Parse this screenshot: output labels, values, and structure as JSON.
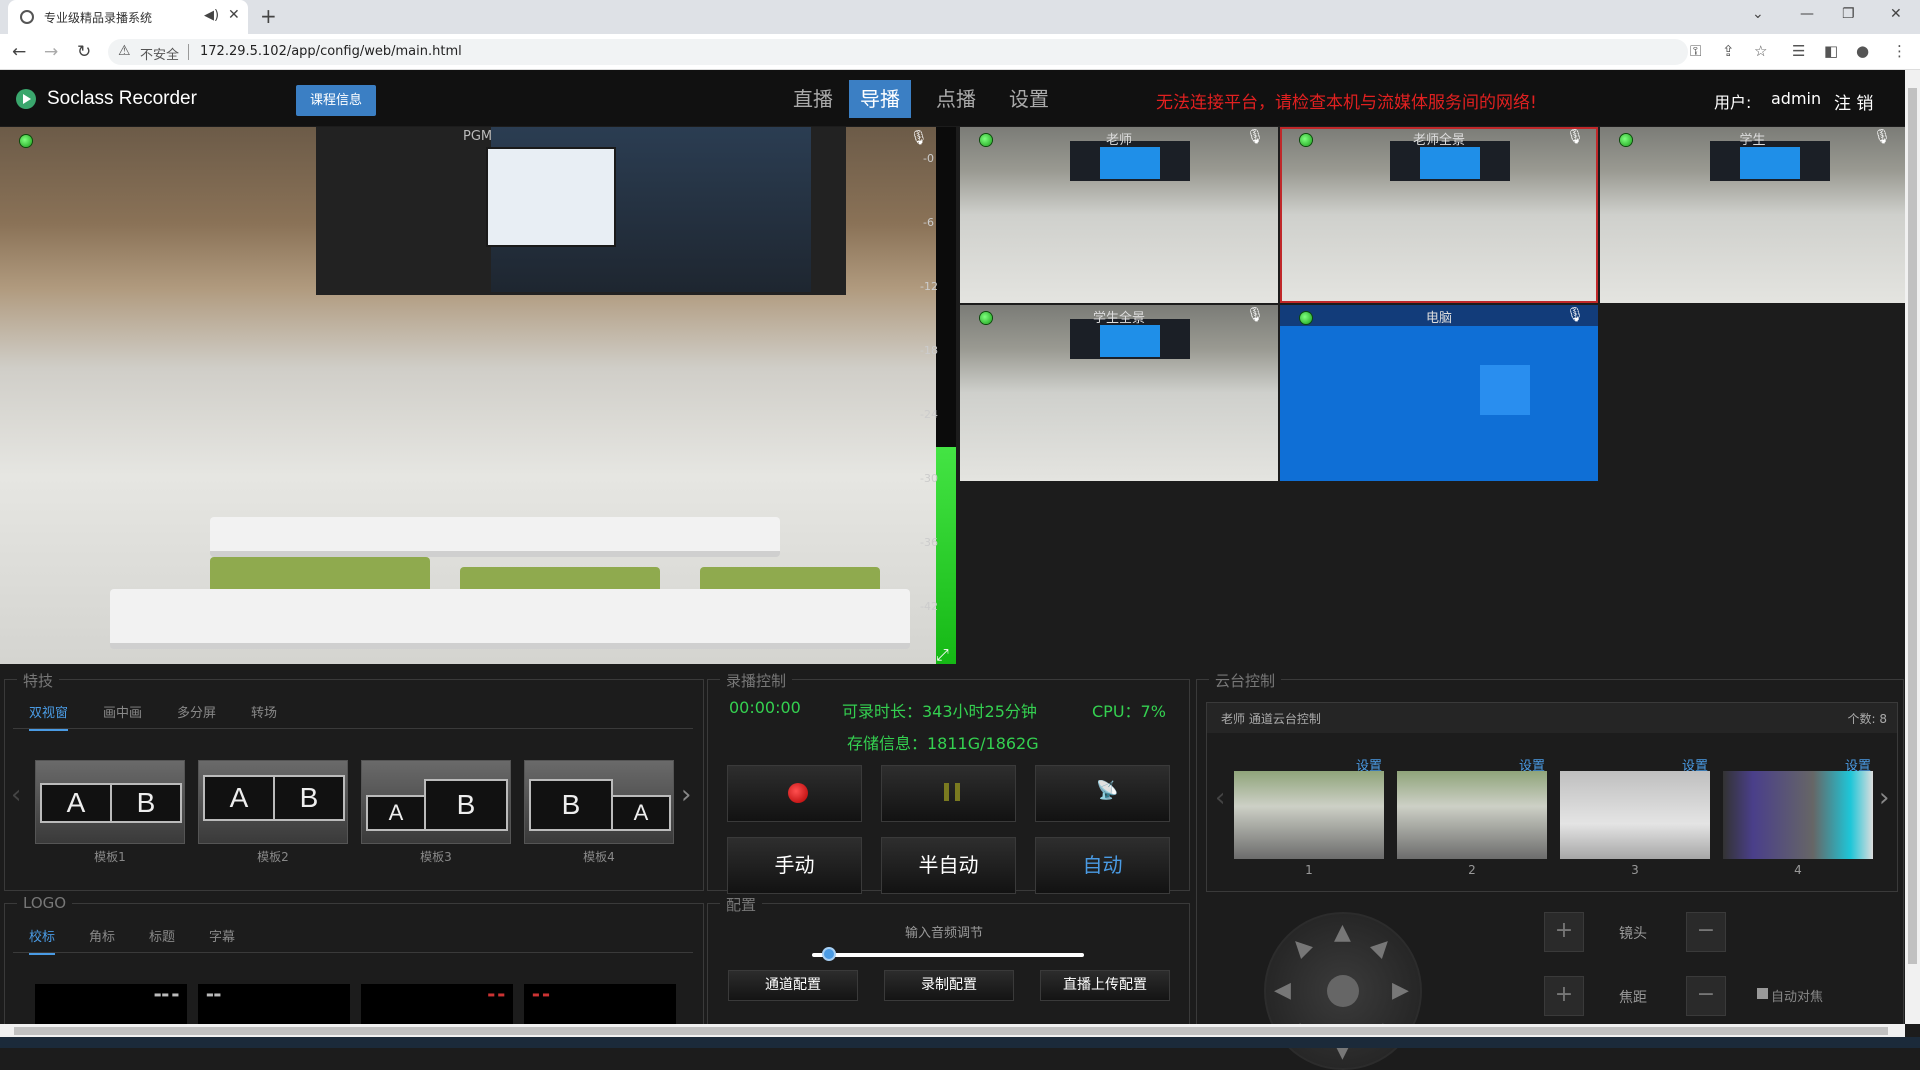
{
  "browser": {
    "tab_title": "专业级精品录播系统",
    "url": "172.29.5.102/app/config/web/main.html",
    "security_label": "不安全"
  },
  "header": {
    "app_name": "Soclass Recorder",
    "course_button": "课程信息",
    "nav": [
      "直播",
      "导播",
      "点播",
      "设置"
    ],
    "active_nav": "导播",
    "warning": "无法连接平台，请检查本机与流媒体服务间的网络!",
    "user_label": "用户:",
    "user_name": "admin",
    "logout": "注 销"
  },
  "pgm": {
    "label": "PGM",
    "meter_ticks": [
      "-0",
      "-6",
      "-12",
      "-18",
      "-24",
      "-30",
      "-36",
      "-42"
    ],
    "audio_level_db": -30
  },
  "cameras": [
    {
      "label": "老师",
      "selected": false
    },
    {
      "label": "老师全景",
      "selected": true
    },
    {
      "label": "学生",
      "selected": false
    },
    {
      "label": "学生全景",
      "selected": false
    },
    {
      "label": "电脑",
      "selected": false
    }
  ],
  "effects": {
    "title": "特技",
    "tabs": [
      "双视窗",
      "画中画",
      "多分屏",
      "转场"
    ],
    "templates": [
      {
        "name": "模板1",
        "a": "A",
        "b": "B"
      },
      {
        "name": "模板2",
        "a": "A",
        "b": "B"
      },
      {
        "name": "模板3",
        "a": "A",
        "b": "B"
      },
      {
        "name": "模板4",
        "a": "B",
        "b": "A"
      }
    ]
  },
  "logo": {
    "title": "LOGO",
    "tabs": [
      "校标",
      "角标",
      "标题",
      "字幕"
    ]
  },
  "record": {
    "title": "录播控制",
    "timer": "00:00:00",
    "duration": "可录时长：343小时25分钟",
    "cpu": "CPU：7%",
    "storage": "存储信息：1811G/1862G",
    "modes": [
      "手动",
      "半自动",
      "自动"
    ],
    "active_mode": "自动"
  },
  "config": {
    "title": "配置",
    "volume_label": "输入音频调节",
    "volume_level": 0.05,
    "buttons": [
      "通道配置",
      "录制配置",
      "直播上传配置"
    ]
  },
  "ptz": {
    "title": "云台控制",
    "channel": "老师 通道云台控制",
    "count": "个数: 8",
    "presets": [
      {
        "set": "设置",
        "num": "1"
      },
      {
        "set": "设置",
        "num": "2"
      },
      {
        "set": "设置",
        "num": "3"
      },
      {
        "set": "设置",
        "num": "4"
      }
    ],
    "lens_label": "镜头",
    "focus_label": "焦距",
    "autofocus": "自动对焦"
  }
}
